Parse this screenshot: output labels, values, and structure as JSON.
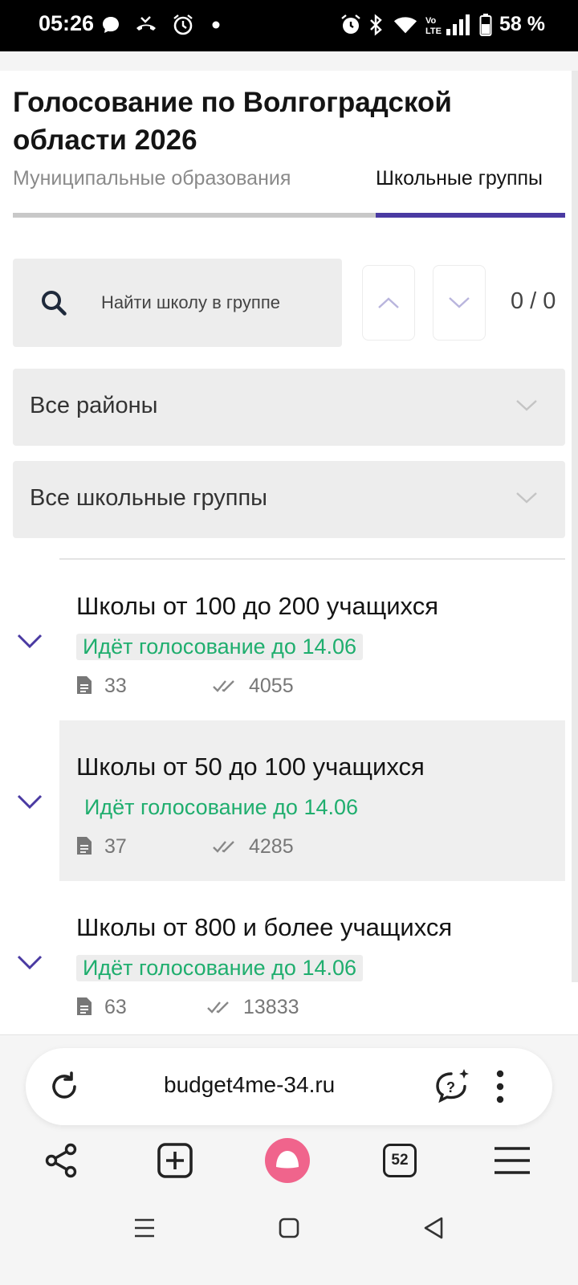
{
  "status_bar": {
    "time": "05:26",
    "battery": "58 %",
    "left_icons": [
      "chat-bubble-icon",
      "missed-call-icon",
      "alarm-icon",
      "dot-icon"
    ],
    "right_icons": [
      "alarm-icon",
      "bluetooth-icon",
      "wifi-icon",
      "volte-icon",
      "signal-icon",
      "battery-icon"
    ]
  },
  "page": {
    "title": "Голосование по Волгоградской области 2026",
    "tabs": [
      {
        "label": "Муниципальные образования",
        "active": false
      },
      {
        "label": "Школьные группы",
        "active": true
      }
    ],
    "search": {
      "placeholder": "Найти школу в группе",
      "value": "",
      "counter": "0 / 0"
    },
    "filters": {
      "district": "Все районы",
      "group": "Все школьные группы"
    },
    "groups": [
      {
        "title": "Школы от 100 до 200 учащихся",
        "status": "Идёт голосование до 14.06",
        "projects": "33",
        "votes": "4055"
      },
      {
        "title": "Школы от 50 до 100 учащихся",
        "status": "Идёт голосование до 14.06",
        "projects": "37",
        "votes": "4285"
      },
      {
        "title": "Школы от 800 и более учащихся",
        "status": "Идёт голосование до 14.06",
        "projects": "63",
        "votes": "13833"
      }
    ]
  },
  "browser": {
    "url": "budget4me-34.ru",
    "tabs_count": "52",
    "toolbar_icons": [
      "share-icon",
      "new-tab-icon",
      "alice-icon",
      "tabs-icon",
      "menu-icon"
    ]
  },
  "colors": {
    "accent": "#4a3aa2",
    "status_green": "#1fae6e",
    "alice_pink": "#f0648c"
  }
}
